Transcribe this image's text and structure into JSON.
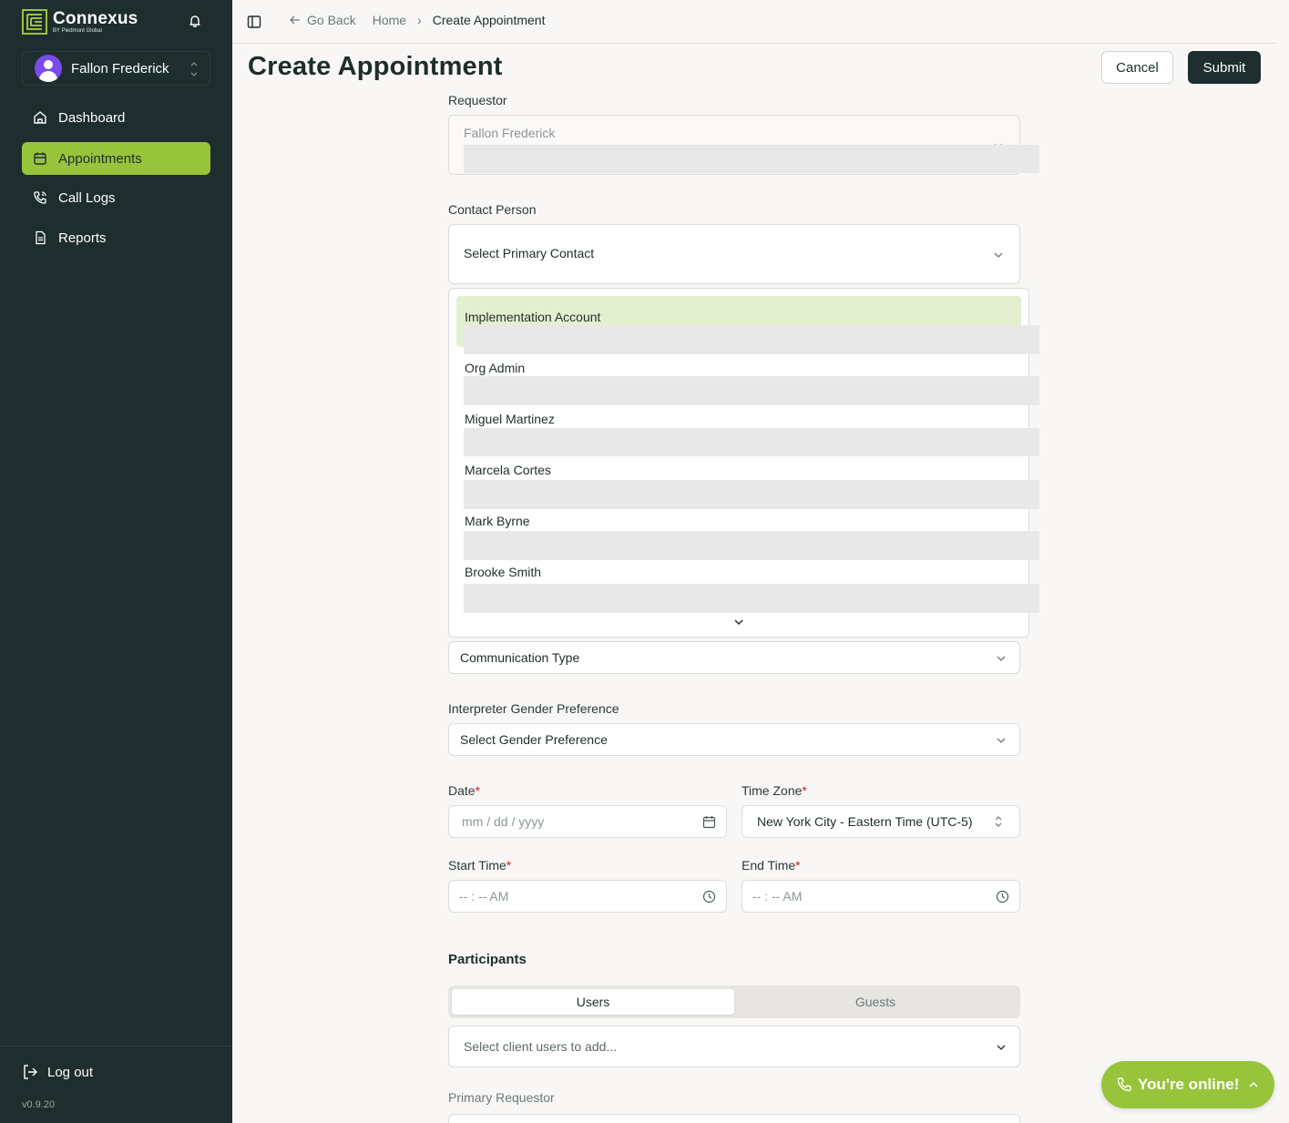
{
  "sidebar": {
    "brand_name": "Connexus",
    "brand_sub": "BY Piedmont Global",
    "user_name": "Fallon Frederick",
    "items": [
      {
        "label": "Dashboard",
        "icon": "home-icon"
      },
      {
        "label": "Appointments",
        "icon": "calendar-icon",
        "active": true
      },
      {
        "label": "Call Logs",
        "icon": "phone-call-icon"
      },
      {
        "label": "Reports",
        "icon": "document-icon"
      }
    ],
    "logout_label": "Log out",
    "version": "v0.9.20"
  },
  "topbar": {
    "go_back": "Go Back",
    "home": "Home",
    "current": "Create Appointment"
  },
  "page": {
    "title": "Create Appointment",
    "cancel_label": "Cancel",
    "submit_label": "Submit"
  },
  "form": {
    "requestor_label": "Requestor",
    "requestor_value": "Fallon Frederick",
    "contact_label": "Contact Person",
    "contact_placeholder": "Select Primary Contact",
    "contact_options": [
      {
        "label": "Implementation Account"
      },
      {
        "label": "Org Admin"
      },
      {
        "label": "Miguel Martinez"
      },
      {
        "label": "Marcela Cortes"
      },
      {
        "label": "Mark Byrne"
      },
      {
        "label": "Brooke Smith"
      }
    ],
    "communication_placeholder": "Communication Type",
    "gender_label": "Interpreter Gender Preference",
    "gender_placeholder": "Select Gender Preference",
    "date_label": "Date",
    "date_placeholder": "mm / dd / yyyy",
    "timezone_label": "Time Zone",
    "timezone_value": "New York City - Eastern Time (UTC-5)",
    "start_label": "Start Time",
    "start_placeholder": "-- : -- AM",
    "end_label": "End Time",
    "end_placeholder": "-- : -- AM",
    "required_mark": "*",
    "participants_label": "Participants",
    "tab_users": "Users",
    "tab_guests": "Guests",
    "client_users_placeholder": "Select client users to add...",
    "primary_requestor_label": "Primary Requestor"
  },
  "status": {
    "online_label": "You're online!"
  },
  "colors": {
    "sidebar_bg": "#1e2d2d",
    "accent": "#98c43c",
    "highlight": "#e4efcf",
    "required": "#d02020"
  }
}
